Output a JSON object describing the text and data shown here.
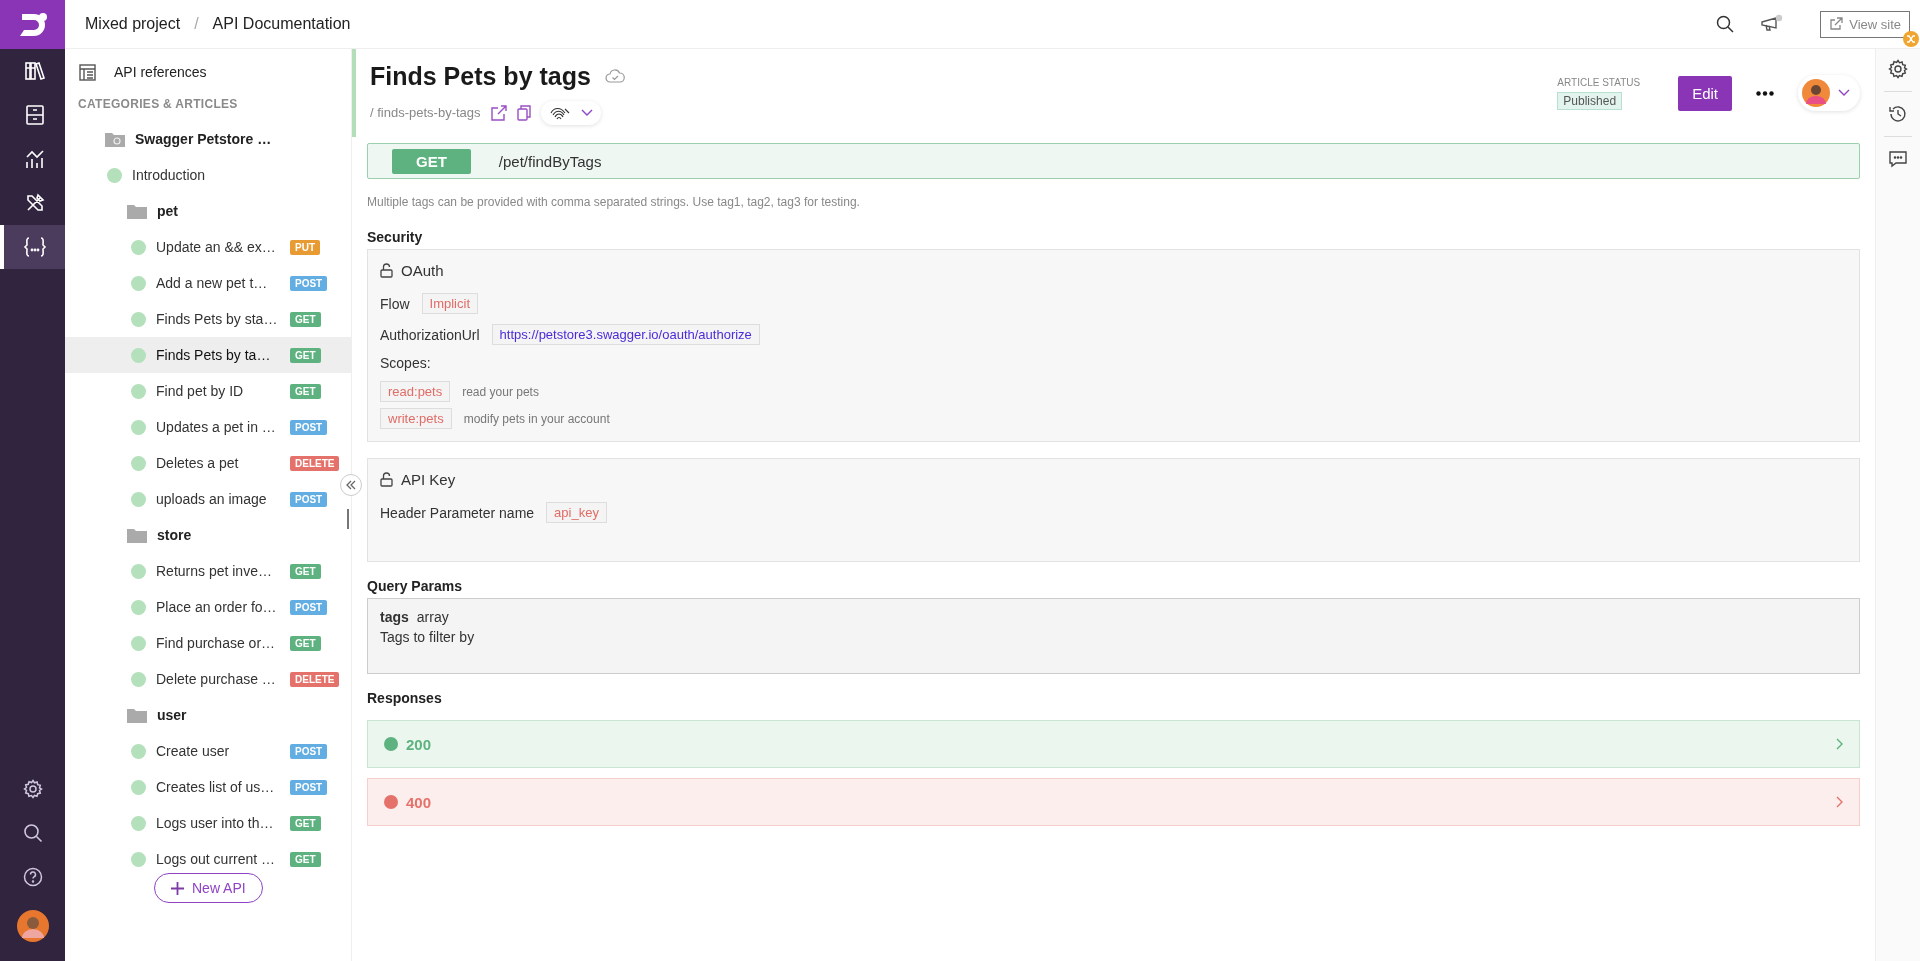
{
  "header": {
    "breadcrumb": [
      "Mixed project",
      "API Documentation"
    ],
    "separator": "/",
    "view_site": "View site"
  },
  "rail": {
    "items": [
      {
        "kind": "library",
        "selected": false
      },
      {
        "kind": "drawer",
        "selected": false
      },
      {
        "kind": "chart",
        "selected": false
      },
      {
        "kind": "tools",
        "selected": false
      },
      {
        "kind": "code",
        "selected": true
      }
    ],
    "bottom": [
      {
        "kind": "settings"
      },
      {
        "kind": "search"
      },
      {
        "kind": "help"
      },
      {
        "kind": "avatar"
      }
    ]
  },
  "sidebar": {
    "api_references": "API references",
    "section_label": "CATEGORIES & ARTICLES",
    "tree": [
      {
        "kind": "category",
        "label": "Swagger Petstore …",
        "children": [
          {
            "kind": "article",
            "label": "Introduction",
            "selected": false
          },
          {
            "kind": "folder",
            "label": "pet",
            "children": [
              {
                "label": "Update an && ex…",
                "method": "PUT",
                "color": "#e99b33",
                "selected": false
              },
              {
                "label": "Add a new pet t…",
                "method": "POST",
                "color": "#62ade2",
                "selected": false
              },
              {
                "label": "Finds Pets by sta…",
                "method": "GET",
                "color": "#5db27f",
                "selected": false
              },
              {
                "label": "Finds Pets by ta…",
                "method": "GET",
                "color": "#5db27f",
                "selected": true
              },
              {
                "label": "Find pet by ID",
                "method": "GET",
                "color": "#5db27f",
                "selected": false
              },
              {
                "label": "Updates a pet in …",
                "method": "POST",
                "color": "#62ade2",
                "selected": false
              },
              {
                "label": "Deletes a pet",
                "method": "DELETE",
                "color": "#e5726a",
                "selected": false
              },
              {
                "label": "uploads an image",
                "method": "POST",
                "color": "#62ade2",
                "selected": false
              }
            ]
          },
          {
            "kind": "folder",
            "label": "store",
            "children": [
              {
                "label": "Returns pet inve…",
                "method": "GET",
                "color": "#5db27f",
                "selected": false
              },
              {
                "label": "Place an order fo…",
                "method": "POST",
                "color": "#62ade2",
                "selected": false
              },
              {
                "label": "Find purchase or…",
                "method": "GET",
                "color": "#5db27f",
                "selected": false
              },
              {
                "label": "Delete purchase …",
                "method": "DELETE",
                "color": "#e5726a",
                "selected": false
              }
            ]
          },
          {
            "kind": "folder",
            "label": "user",
            "children": [
              {
                "label": "Create user",
                "method": "POST",
                "color": "#62ade2",
                "selected": false
              },
              {
                "label": "Creates list of us…",
                "method": "POST",
                "color": "#62ade2",
                "selected": false
              },
              {
                "label": "Logs user into th…",
                "method": "GET",
                "color": "#5db27f",
                "selected": false
              },
              {
                "label": "Logs out current …",
                "method": "GET",
                "color": "#5db27f",
                "selected": false
              }
            ]
          }
        ]
      }
    ],
    "new_button": "New API"
  },
  "article": {
    "title": "Finds Pets by tags",
    "slug": "/ finds-pets-by-tags",
    "status_label": "ARTICLE STATUS",
    "status": "Published",
    "edit": "Edit"
  },
  "endpoint": {
    "method": "GET",
    "path": "/pet/findByTags"
  },
  "description": "Multiple tags can be provided with comma separated strings. Use tag1, tag2, tag3 for testing.",
  "security": {
    "heading": "Security",
    "oauth": {
      "name": "OAuth",
      "flow_label": "Flow",
      "flow": "Implicit",
      "url_label": "AuthorizationUrl",
      "url": "https://petstore3.swagger.io/oauth/authorize",
      "scopes_label": "Scopes:",
      "scopes": [
        {
          "name": "read:pets",
          "description": "read your pets"
        },
        {
          "name": "write:pets",
          "description": "modify pets in your account"
        }
      ]
    },
    "api_key": {
      "name": "API Key",
      "label": "Header Parameter name",
      "value": "api_key"
    }
  },
  "query_params": {
    "heading": "Query Params",
    "params": [
      {
        "name": "tags",
        "type": "array",
        "description": "Tags to filter by"
      }
    ]
  },
  "responses": {
    "heading": "Responses",
    "items": [
      {
        "code": "200",
        "color": "#5db27f"
      },
      {
        "code": "400",
        "color": "#e5726a"
      }
    ]
  }
}
